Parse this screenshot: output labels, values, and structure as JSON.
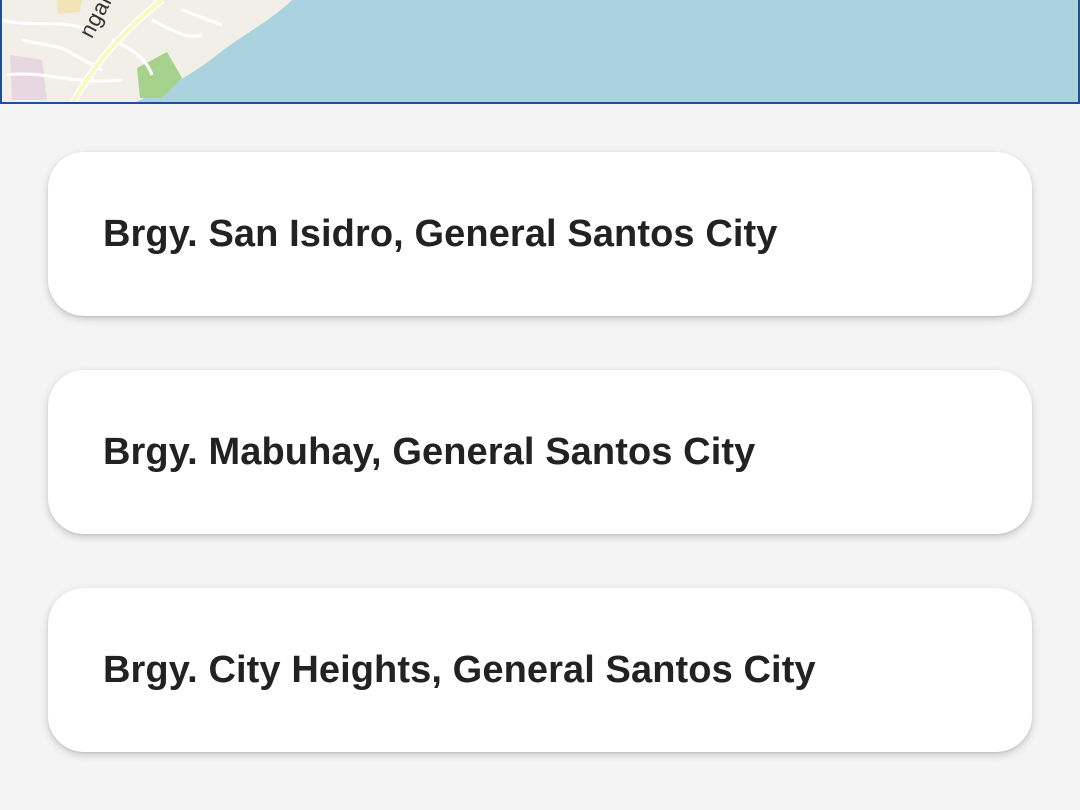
{
  "map": {
    "road_label": "ngal Road",
    "colors": {
      "water": "#aad3df",
      "land": "#f2efe9",
      "park": "#a7d28e",
      "border": "#1f4f96"
    }
  },
  "locations": [
    {
      "label": "Brgy. San Isidro, General Santos City"
    },
    {
      "label": "Brgy. Mabuhay, General Santos City"
    },
    {
      "label": "Brgy. City Heights, General Santos City"
    }
  ]
}
